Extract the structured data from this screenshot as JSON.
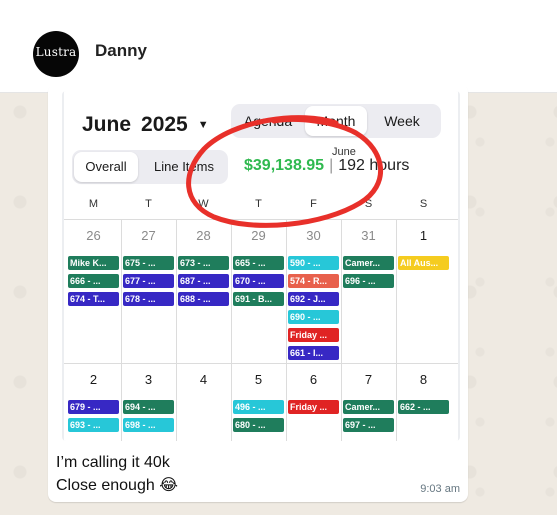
{
  "chat": {
    "contact_name": "Danny",
    "avatar_logo": "Lustra"
  },
  "message": {
    "line1": "I’m calling it 40k",
    "line2": "Close enough 😂",
    "time": "9:03 am"
  },
  "calendar": {
    "month_label": "June",
    "year_label": "2025",
    "dropdown_icon": "caret-down-icon",
    "views": [
      "Agenda",
      "Month",
      "Week"
    ],
    "active_view": "Month",
    "scope_tabs": [
      "Overall",
      "Line Items"
    ],
    "active_scope": "Overall",
    "totals_label": "June",
    "total_amount": "$39,138.95",
    "separator": "|",
    "total_hours": "192 hours",
    "weekdays": [
      "M",
      "T",
      "W",
      "T",
      "F",
      "S",
      "S"
    ],
    "weeks": [
      {
        "days": [
          {
            "num": "26",
            "current": false,
            "events": [
              {
                "label": "Mike K...",
                "color": "#1f7d5c"
              },
              {
                "label": "666 - ...",
                "color": "#1f7d5c"
              },
              {
                "label": "674 - T...",
                "color": "#3728c4"
              }
            ]
          },
          {
            "num": "27",
            "current": false,
            "events": [
              {
                "label": "675 - ...",
                "color": "#1f7d5c"
              },
              {
                "label": "677 - ...",
                "color": "#3728c4"
              },
              {
                "label": "678 - ...",
                "color": "#3728c4"
              }
            ]
          },
          {
            "num": "28",
            "current": false,
            "events": [
              {
                "label": "673 - ...",
                "color": "#1f7d5c"
              },
              {
                "label": "687 - ...",
                "color": "#3728c4"
              },
              {
                "label": "688 - ...",
                "color": "#3728c4"
              }
            ]
          },
          {
            "num": "29",
            "current": false,
            "events": [
              {
                "label": "665 - ...",
                "color": "#1f7d5c"
              },
              {
                "label": "670 - ...",
                "color": "#3728c4"
              },
              {
                "label": "691 - B...",
                "color": "#1f7d5c"
              }
            ]
          },
          {
            "num": "30",
            "current": false,
            "events": [
              {
                "label": "590 - ...",
                "color": "#27c7d8"
              },
              {
                "label": "574 - R...",
                "color": "#e8604c"
              },
              {
                "label": "692 - J...",
                "color": "#3728c4"
              },
              {
                "label": "690 - ...",
                "color": "#27c7d8"
              },
              {
                "label": "Friday ...",
                "color": "#e02424"
              },
              {
                "label": "661 - I...",
                "color": "#3728c4"
              }
            ]
          },
          {
            "num": "31",
            "current": false,
            "events": [
              {
                "label": "Camer...",
                "color": "#1f7d5c"
              },
              {
                "label": "696 - ...",
                "color": "#1f7d5c"
              }
            ]
          },
          {
            "num": "1",
            "current": true,
            "events": [
              {
                "label": "All Aus...",
                "color": "#f5cc1f"
              }
            ]
          }
        ]
      },
      {
        "days": [
          {
            "num": "2",
            "current": true,
            "events": [
              {
                "label": "679 - ...",
                "color": "#3728c4"
              },
              {
                "label": "693 - ...",
                "color": "#27c7d8"
              }
            ]
          },
          {
            "num": "3",
            "current": true,
            "events": [
              {
                "label": "694 - ...",
                "color": "#1f7d5c"
              },
              {
                "label": "698 - ...",
                "color": "#27c7d8"
              }
            ]
          },
          {
            "num": "4",
            "current": true,
            "events": []
          },
          {
            "num": "5",
            "current": true,
            "events": [
              {
                "label": "496 - ...",
                "color": "#27c7d8"
              },
              {
                "label": "680 - ...",
                "color": "#1f7d5c"
              }
            ]
          },
          {
            "num": "6",
            "current": true,
            "events": [
              {
                "label": "Friday ...",
                "color": "#e02424"
              }
            ]
          },
          {
            "num": "7",
            "current": true,
            "events": [
              {
                "label": "Camer...",
                "color": "#1f7d5c"
              },
              {
                "label": "697 - ...",
                "color": "#1f7d5c"
              }
            ]
          },
          {
            "num": "8",
            "current": true,
            "events": [
              {
                "label": "662 - ...",
                "color": "#1f7d5c"
              }
            ]
          }
        ]
      }
    ]
  },
  "colors": {
    "chat_background": "#efeae2",
    "amount_green": "#2fb94f",
    "annotation_red": "#e8302a"
  }
}
